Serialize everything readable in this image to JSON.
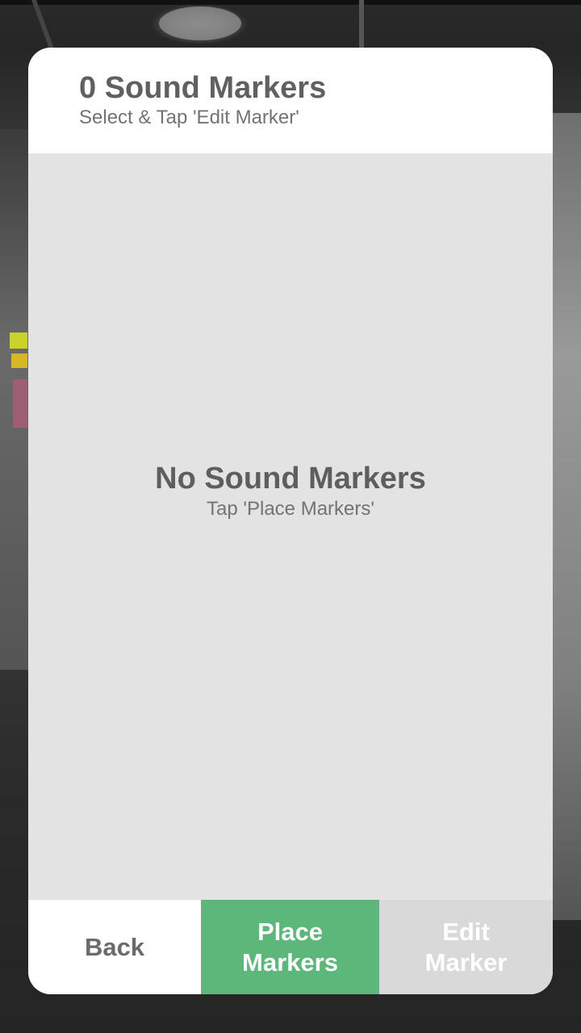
{
  "header": {
    "title": "0 Sound Markers",
    "subtitle": "Select & Tap 'Edit Marker'"
  },
  "empty_state": {
    "title": "No Sound Markers",
    "subtitle": "Tap 'Place Markers'"
  },
  "toolbar": {
    "back_label": "Back",
    "place_label_line1": "Place",
    "place_label_line2": "Markers",
    "edit_label_line1": "Edit",
    "edit_label_line2": "Marker"
  },
  "colors": {
    "accent": "#5cb87a",
    "disabled": "#d9d9d9",
    "panel": "#e3e3e3"
  }
}
